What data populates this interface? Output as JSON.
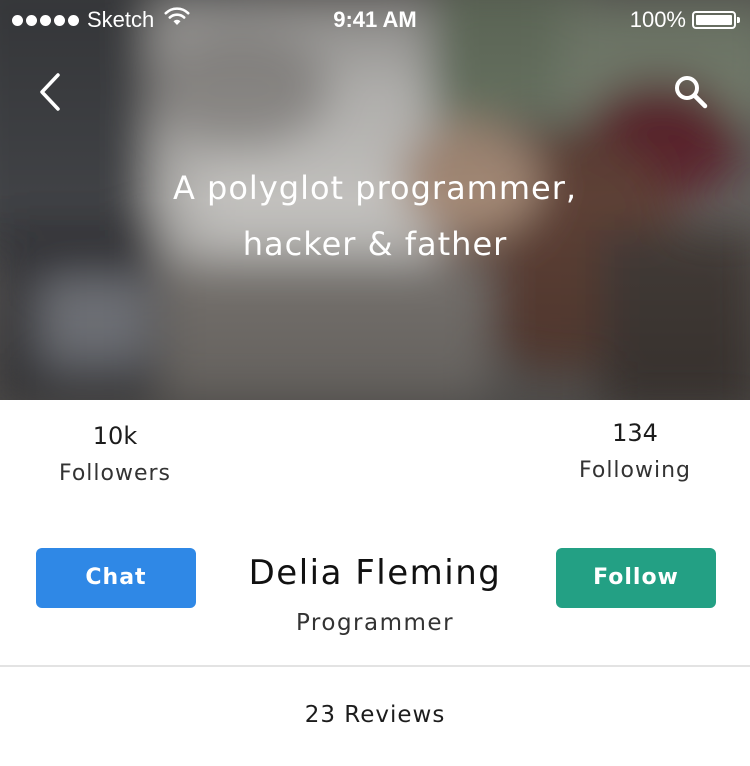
{
  "status_bar": {
    "carrier": "Sketch",
    "time": "9:41 AM",
    "battery": "100%",
    "signal_icon": "signal-dots-icon",
    "wifi_icon": "wifi-icon",
    "battery_icon": "battery-icon"
  },
  "header": {
    "back_icon": "chevron-left-icon",
    "search_icon": "search-icon",
    "tagline_line1": "A polyglot programmer,",
    "tagline_line2": "hacker & father"
  },
  "stats": {
    "followers": {
      "value": "10k",
      "label": "Followers"
    },
    "following": {
      "value": "134",
      "label": "Following"
    }
  },
  "profile": {
    "name": "Delia Fleming",
    "role": "Programmer"
  },
  "actions": {
    "chat_label": "Chat",
    "follow_label": "Follow"
  },
  "reviews": {
    "label": "23 Reviews"
  },
  "colors": {
    "chat_button": "#2f88e6",
    "follow_button": "#23a084",
    "hero_overlay": "#5d5a56"
  }
}
